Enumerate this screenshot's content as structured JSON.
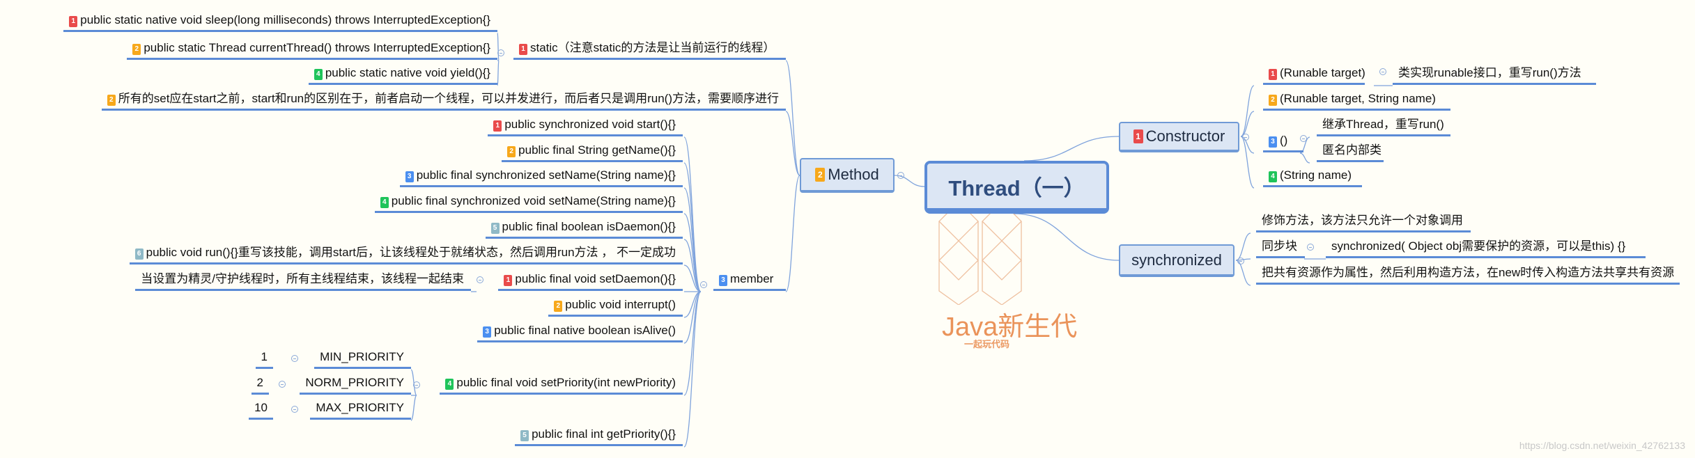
{
  "central": "Thread（一）",
  "method": {
    "label": "Method",
    "badge": "2",
    "static": {
      "label": "static（注意static的方法是让当前运行的线程）",
      "badge": "1",
      "children": [
        {
          "badge": "1",
          "text": "public static native void sleep(long milliseconds) throws InterruptedException{}"
        },
        {
          "badge": "2",
          "text": "public static Thread currentThread() throws InterruptedException{}"
        },
        {
          "badge": "4",
          "text": "public static native void yield(){}"
        }
      ]
    },
    "set_note": {
      "badge": "2",
      "text": "所有的set应在start之前，start和run的区别在于，前者启动一个线程，可以并发进行，而后者只是调用run()方法，需要顺序进行"
    },
    "member": {
      "label": "member",
      "badge": "3",
      "children": [
        {
          "badge": "1",
          "text": "public synchronized void start(){}"
        },
        {
          "badge": "2",
          "text": "public final String getName(){}"
        },
        {
          "badge": "3",
          "text": "public final synchronized setName(String name){}"
        },
        {
          "badge": "4",
          "text": "public final synchronized void setName(String name){}"
        },
        {
          "badge": "5",
          "text": "public final boolean isDaemon(){}"
        },
        {
          "badge": "6",
          "text": "public void run(){}重写该技能，调用start后，让该线程处于就绪状态，然后调用run方法 ， 不一定成功"
        },
        {
          "badge": "1",
          "text": "public final void setDaemon(){}",
          "note": "当设置为精灵/守护线程时，所有主线程结束，该线程一起结束"
        },
        {
          "badge": "2",
          "text": "public void interrupt()"
        },
        {
          "badge": "3",
          "text": "public final native boolean isAlive()"
        },
        {
          "badge": "4",
          "text": "public final void setPriority(int newPriority)"
        },
        {
          "badge": "5",
          "text": "public final int getPriority(){}"
        }
      ],
      "priorities": [
        {
          "value": "1",
          "name": "MIN_PRIORITY"
        },
        {
          "value": "2",
          "name": "NORM_PRIORITY"
        },
        {
          "value": "10",
          "name": "MAX_PRIORITY"
        }
      ]
    }
  },
  "constructor": {
    "label": "Constructor",
    "badge": "1",
    "children": [
      {
        "badge": "1",
        "text": "(Runable target)",
        "note": "类实现runable接口，重写run()方法"
      },
      {
        "badge": "2",
        "text": "(Runable target, String name)"
      },
      {
        "badge": "3",
        "text": "()",
        "subs": [
          "继承Thread，重写run()",
          "匿名内部类"
        ]
      },
      {
        "badge": "4",
        "text": "(String name)"
      }
    ]
  },
  "synchronized": {
    "label": "synchronized",
    "children": [
      {
        "text": "修饰方法，该方法只允许一个对象调用"
      },
      {
        "text": "同步块",
        "note": "synchronized( Object obj需要保护的资源，可以是this) {}"
      },
      {
        "text": "把共有资源作为属性，然后利用构造方法，在new时传入构造方法共享共有资源"
      }
    ]
  },
  "watermark": {
    "brand": "Java新生代",
    "slogan": "一起玩代码",
    "url": "https://blog.csdn.net/weixin_42762133"
  },
  "colors": {
    "line": "#5b8bd6",
    "node_fill": "#dce6f4",
    "badge1": "#e94b4b",
    "badge2": "#f7a81b",
    "badge3": "#4b8ff0",
    "badge4": "#1fc45a",
    "badge5": "#8fb9c6"
  }
}
